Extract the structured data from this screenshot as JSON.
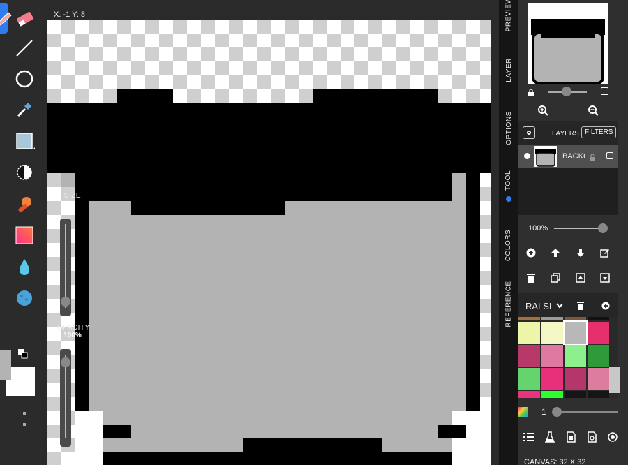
{
  "coords": "X: -1 Y: 8",
  "size_slider": {
    "label": "SIZE",
    "value": "1"
  },
  "opacity_slider": {
    "label": "OPACITY",
    "value": "100%"
  },
  "tabs": {
    "preview": "PREVIEW",
    "layer": "LAYER",
    "options": "OPTIONS",
    "tool": "TOOL",
    "colors": "COLORS",
    "reference": "REFERENCE"
  },
  "layers": {
    "title": "LAYERS (1)",
    "filters_label": "FILTERS",
    "layer_name": "BACKGROUND"
  },
  "opacity_percent": "100%",
  "palette": {
    "name": "RALSEI",
    "swatches": [
      "#eef5a8",
      "#f4f6c4",
      "#b8b8b8",
      "#e6306e",
      "#b9386a",
      "#e079a2",
      "#8cf08c",
      "#2e9a3a",
      "#66d46e",
      "#e8307a",
      "#b4366a",
      "#de7ca0",
      "#e8347a",
      "#2dff2d",
      "#151515",
      "#151515"
    ],
    "top_strip": [
      "#a86e3c",
      "#9a9a9a",
      "#7a5a3a",
      "#111111"
    ]
  },
  "brush_count": "1",
  "canvas_size": "CANVAS: 32 X 32",
  "colors": {
    "primary": "#b3b3b3",
    "secondary": "#ffffff",
    "accent": "#2f7cf0",
    "fill": "#b3b3b3",
    "outline": "#000000"
  },
  "icons": {
    "toolbar": [
      "pencil-icon",
      "eraser-icon",
      "line-icon",
      "circle-icon",
      "eyedropper-icon",
      "rectangle-select-icon",
      "dodge-burn-icon",
      "stamp-icon",
      "gradient-icon",
      "water-drop-icon",
      "smudge-icon"
    ],
    "layer_actions": [
      "add-icon",
      "move-up-icon",
      "move-down-icon",
      "edit-icon",
      "delete-icon",
      "duplicate-icon",
      "merge-up-icon",
      "merge-down-icon"
    ],
    "bottom": [
      "list-icon",
      "flask-icon",
      "export-file-icon",
      "gif-file-icon",
      "record-icon"
    ]
  }
}
